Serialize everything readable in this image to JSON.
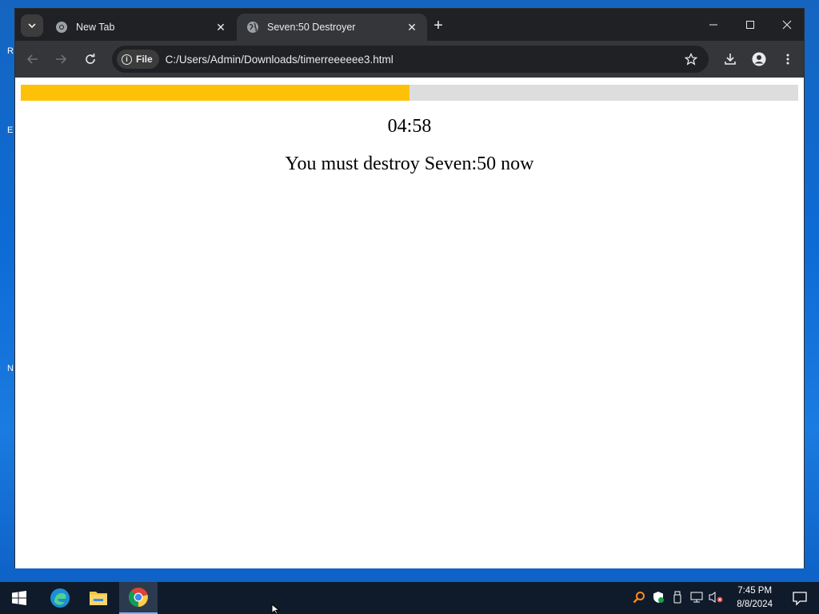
{
  "desktop": {
    "fragments": [
      "R",
      "E",
      "N"
    ]
  },
  "browser": {
    "tabs": [
      {
        "label": "New Tab",
        "active": false,
        "favicon": "chrome-icon"
      },
      {
        "label": "Seven:50 Destroyer",
        "active": true,
        "favicon": "globe-icon"
      }
    ],
    "omnibox": {
      "chip_label": "File",
      "url": "C:/Users/Admin/Downloads/timerreeeeee3.html"
    }
  },
  "page": {
    "progress_fraction": 0.5,
    "progress_color": "#ffc107",
    "timer": "04:58",
    "message": "You must destroy Seven:50 now"
  },
  "taskbar": {
    "apps": [
      "start-icon",
      "edge-icon",
      "file-explorer-icon",
      "chrome-icon"
    ],
    "time": "7:45 PM",
    "date": "8/8/2024"
  }
}
